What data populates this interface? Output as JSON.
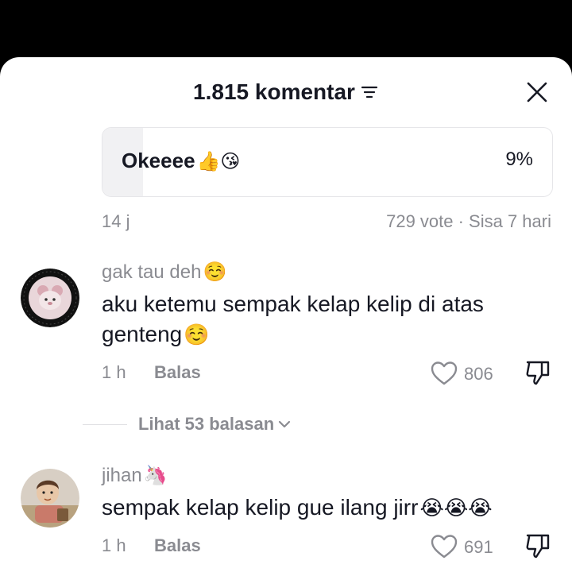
{
  "header": {
    "title": "1.815 komentar"
  },
  "poll": {
    "option_label": "Okeeee",
    "option_emojis": "👍😘",
    "percent_text": "9%",
    "percent_value": 9,
    "time": "14 j",
    "meta": "729 vote · Sisa 7 hari"
  },
  "comments": [
    {
      "username": "gak tau deh",
      "username_emoji": "☺️",
      "text": "aku ketemu sempak kelap kelip di atas genteng",
      "text_emoji": "☺️",
      "time": "1 h",
      "reply_label": "Balas",
      "likes": "806",
      "view_replies": "Lihat 53 balasan"
    },
    {
      "username": "jihan",
      "username_emoji": "🦄",
      "text": "sempak kelap kelip gue ilang jirr",
      "text_emoji": "😭😭😭",
      "time": "1 h",
      "reply_label": "Balas",
      "likes": "691"
    }
  ],
  "colors": {
    "text_primary": "#161823",
    "text_secondary": "#8a8b91",
    "background": "#ffffff",
    "status_bar": "#000000"
  },
  "icons": [
    "sort-icon",
    "close-icon",
    "heart-icon",
    "dislike-icon",
    "chevron-down-icon"
  ]
}
